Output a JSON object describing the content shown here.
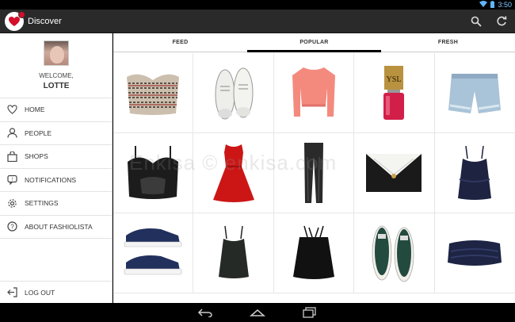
{
  "status_bar": {
    "time": "3:50"
  },
  "action_bar": {
    "title": "Discover"
  },
  "sidebar": {
    "welcome": "WELCOME,",
    "username": "LOTTE",
    "items": [
      {
        "label": "HOME",
        "icon": "heart-icon"
      },
      {
        "label": "PEOPLE",
        "icon": "people-icon"
      },
      {
        "label": "SHOPS",
        "icon": "shopping-bag-icon"
      },
      {
        "label": "NOTIFICATIONS",
        "icon": "notification-icon"
      },
      {
        "label": "SETTINGS",
        "icon": "gear-icon"
      },
      {
        "label": "ABOUT FASHIOLISTA",
        "icon": "question-icon"
      }
    ],
    "logout": "LOG OUT"
  },
  "tabs": [
    {
      "label": "FEED",
      "active": false
    },
    {
      "label": "POPULAR",
      "active": true
    },
    {
      "label": "FRESH",
      "active": false
    }
  ],
  "products": [
    "tribal-bustier-top",
    "white-oxford-shoes",
    "coral-knit-sweater",
    "red-nail-polish",
    "denim-shorts",
    "black-lace-bustier",
    "red-skater-dress",
    "black-leather-pants",
    "black-white-clutch",
    "navy-camisole",
    "navy-white-sneakers",
    "black-camisole",
    "black-cutout-top",
    "green-slip-on-sneakers",
    "navy-bandeau-top"
  ],
  "watermark": "Enkisa © enkisa.com",
  "colors": {
    "accent": "#d40f2b",
    "actionbar": "#2a2a2a",
    "tab_indicator": "#000000"
  }
}
